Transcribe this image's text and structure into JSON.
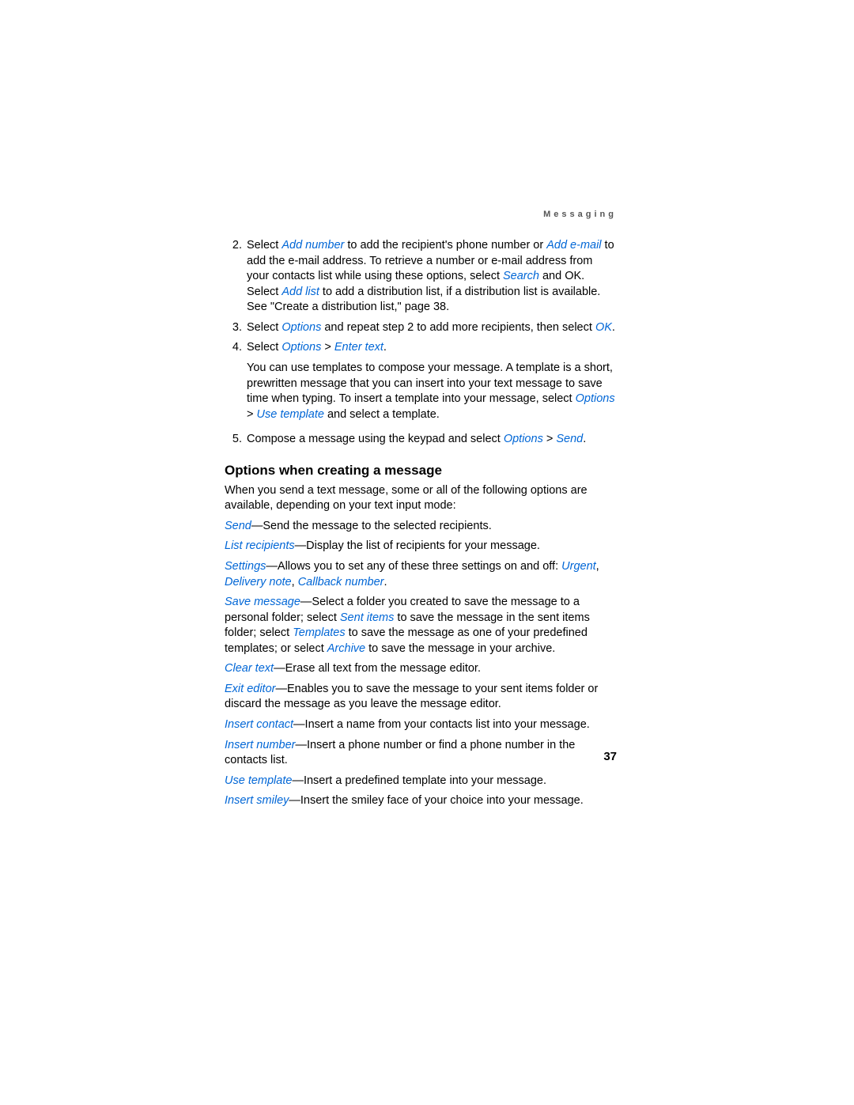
{
  "header": {
    "running": "Messaging"
  },
  "steps": [
    {
      "n": "2.",
      "pre": "Select ",
      "t1": "Add number",
      "mid1": " to add the recipient's phone number or ",
      "t2": "Add e-mail",
      "mid2": " to add the e-mail address. To retrieve a number or e-mail address from your contacts list while using these options, select ",
      "t3": "Search",
      "mid3": " and ",
      "ok1": "OK",
      "mid4": ". Select ",
      "t4": "Add list",
      "tail": " to add a distribution list, if a distribution list is available. See \"Create a distribution list,\" page 38."
    },
    {
      "n": "3.",
      "pre": "Select ",
      "t1": "Options",
      "mid1": " and repeat step 2 to add more recipients, then select ",
      "ok1": "OK",
      "tail": "."
    },
    {
      "n": "4.",
      "pre": "Select ",
      "t1": "Options",
      "gt": " > ",
      "t2": "Enter text",
      "tail": ".",
      "sub_pre": "You can use templates to compose your message. A template is a short, prewritten message that you can insert into your text message to save time when typing. To insert a template into your message, select ",
      "sub_t1": "Options",
      "sub_gt": " > ",
      "sub_t2": "Use template",
      "sub_tail": " and select a template."
    },
    {
      "n": "5.",
      "pre": "Compose a message using the keypad and select ",
      "t1": "Options",
      "gt": " > ",
      "t2": "Send",
      "tail": "."
    }
  ],
  "section": {
    "title": "Options when creating a message",
    "intro": "When you send a text message, some or all of the following options are available, depending on your text input mode:"
  },
  "opts": {
    "send": {
      "term": "Send",
      "desc": "—Send the message to the selected recipients."
    },
    "listrec": {
      "term": "List recipients",
      "desc": "—Display the list of recipients for your message."
    },
    "settings": {
      "term": "Settings",
      "desc1": "—Allows you to set any of these three settings on and off: ",
      "u": "Urgent",
      "c1": ", ",
      "d": "Delivery note",
      "c2": ", ",
      "cb": "Callback number",
      "end": "."
    },
    "save": {
      "term": "Save message",
      "d1": "—Select a folder you created to save the message to a personal folder; select ",
      "sent": "Sent items",
      "d2": " to save the message in the sent items folder; select ",
      "tmpl": "Templates",
      "d3": " to save the message as one of your predefined templates; or select ",
      "arch": "Archive",
      "d4": " to save the message in your archive."
    },
    "clear": {
      "term": "Clear text",
      "desc": "—Erase all text from the message editor."
    },
    "exit": {
      "term": "Exit editor",
      "desc": "—Enables you to save the message to your sent items folder or discard the message as you leave the message editor."
    },
    "icontact": {
      "term": "Insert contact",
      "desc": "—Insert a name from your contacts list into your message."
    },
    "inum": {
      "term": "Insert number",
      "desc": "—Insert a phone number or find a phone number in the contacts list."
    },
    "utmpl": {
      "term": "Use template",
      "desc": "—Insert a predefined template into your message."
    },
    "ismiley": {
      "term": "Insert smiley",
      "desc": "—Insert the smiley face of your choice into your message."
    }
  },
  "page_number": "37"
}
